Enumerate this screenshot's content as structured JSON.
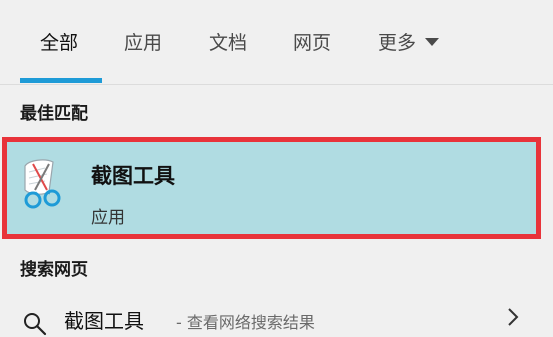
{
  "tabs": [
    {
      "label": "全部",
      "active": true
    },
    {
      "label": "应用"
    },
    {
      "label": "文档"
    },
    {
      "label": "网页"
    },
    {
      "label": "更多"
    }
  ],
  "colors": {
    "accent": "#1e9bd7",
    "highlight_border": "#e8333a",
    "selected_bg": "#b0dce2",
    "background": "#f0f0f0"
  },
  "best_match": {
    "heading": "最佳匹配",
    "app_name": "截图工具",
    "app_type": "应用",
    "icon": "snipping-tool-icon"
  },
  "web_search": {
    "heading": "搜索网页",
    "query": "截图工具",
    "hint": "- 查看网络搜索结果",
    "icon": "search-icon",
    "arrow_icon": "chevron-right-icon"
  }
}
